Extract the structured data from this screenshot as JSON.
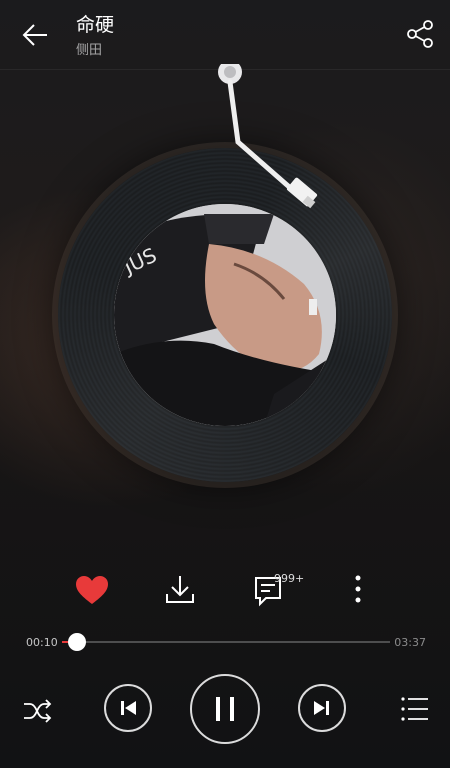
{
  "header": {
    "title": "命硬",
    "artist": "侧田",
    "back_icon": "arrow-left-icon",
    "share_icon": "share-icon"
  },
  "player": {
    "album_art": "album-cover-image",
    "tonearm": "tonearm-icon"
  },
  "actions": {
    "like_icon": "heart-icon",
    "like_color": "#e83a3a",
    "download_icon": "download-icon",
    "comment_icon": "comment-icon",
    "comment_count": "999+",
    "more_icon": "more-vertical-icon"
  },
  "progress": {
    "elapsed": "00:10",
    "total": "03:37",
    "fraction": 0.046,
    "accent": "#e83a3a"
  },
  "controls": {
    "shuffle_icon": "shuffle-icon",
    "prev_icon": "previous-icon",
    "pause_icon": "pause-icon",
    "next_icon": "next-icon",
    "playlist_icon": "playlist-icon"
  }
}
